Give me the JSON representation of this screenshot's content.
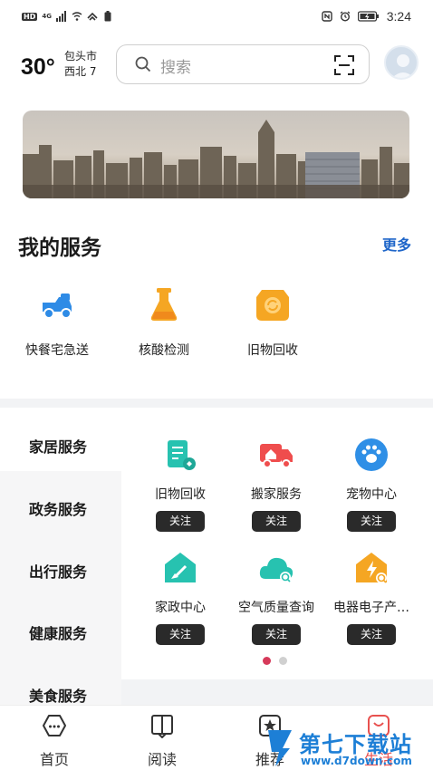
{
  "status_bar": {
    "left_text": "HD",
    "network": "4G",
    "time": "3:24"
  },
  "header": {
    "temperature": "30°",
    "city": "包头市",
    "wind": "西北  7",
    "search_placeholder": "搜索"
  },
  "my_services": {
    "title": "我的服务",
    "more": "更多",
    "items": [
      {
        "label": "快餐宅急送",
        "icon": "delivery-icon",
        "color": "#2e8be6"
      },
      {
        "label": "核酸检测",
        "icon": "test-tube-icon",
        "color": "#f5a623"
      },
      {
        "label": "旧物回收",
        "icon": "recycle-icon",
        "color": "#f5a623"
      }
    ]
  },
  "categories": [
    {
      "label": "家居服务"
    },
    {
      "label": "政务服务"
    },
    {
      "label": "出行服务"
    },
    {
      "label": "健康服务"
    },
    {
      "label": "美食服务"
    }
  ],
  "grid": {
    "follow_label": "关注",
    "items": [
      {
        "label": "旧物回收",
        "icon": "document-recycle-icon",
        "color": "#27c2b0"
      },
      {
        "label": "搬家服务",
        "icon": "moving-truck-icon",
        "color": "#ef4d4d"
      },
      {
        "label": "宠物中心",
        "icon": "paw-icon",
        "color": "#2f8fe6"
      },
      {
        "label": "家政中心",
        "icon": "cleaning-home-icon",
        "color": "#27c2b0"
      },
      {
        "label": "空气质量查询",
        "icon": "air-cloud-icon",
        "color": "#27c2b0"
      },
      {
        "label": "电器电子产…",
        "icon": "electric-home-icon",
        "color": "#f5a623"
      }
    ],
    "page_count": 2,
    "active_page": 1
  },
  "bottom_nav": {
    "items": [
      {
        "label": "首页",
        "icon": "home-chat-icon"
      },
      {
        "label": "阅读",
        "icon": "book-icon"
      },
      {
        "label": "推荐",
        "icon": "star-icon"
      },
      {
        "label": "生活",
        "icon": "life-icon"
      }
    ]
  },
  "watermark": {
    "brand": "第七下载站",
    "url": "www.d7down.com"
  }
}
